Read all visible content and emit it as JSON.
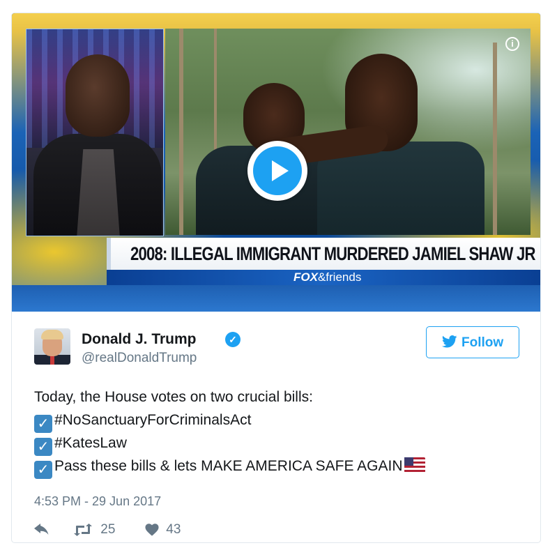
{
  "video": {
    "headline": "2008: ILLEGAL IMMIGRANT MURDERED JAMIEL SHAW JR",
    "brand_bold": "FOX",
    "brand_rest": "&friends",
    "info_glyph": "i",
    "play_icon": "play-icon"
  },
  "tweet": {
    "author_name": "Donald J. Trump",
    "handle": "@realDonaldTrump",
    "verified": true,
    "follow_label": "Follow",
    "lines": [
      "Today, the House votes on two crucial bills:",
      "#NoSanctuaryForCriminalsAct",
      "#KatesLaw",
      "Pass these bills & lets MAKE AMERICA SAFE AGAIN"
    ],
    "timestamp": "4:53 PM - 29 Jun 2017",
    "retweet_count": "25",
    "like_count": "43"
  },
  "colors": {
    "accent": "#1da1f2",
    "text": "#14171a",
    "muted": "#657786",
    "border": "#e1e8ed"
  }
}
